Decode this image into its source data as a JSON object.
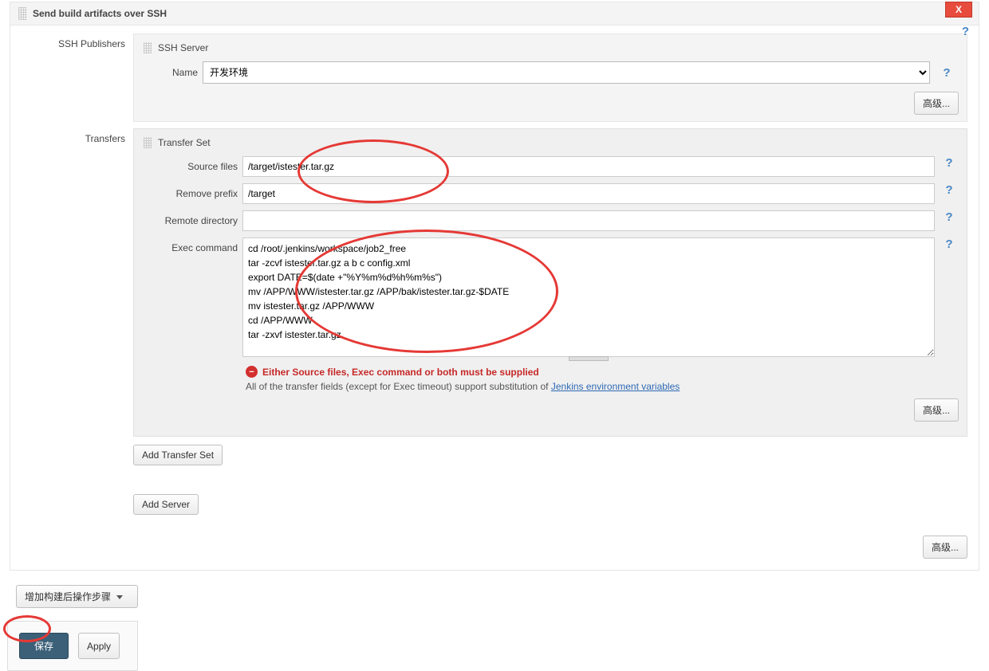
{
  "section": {
    "title": "Send build artifacts over SSH",
    "close": "X"
  },
  "labels": {
    "ssh_publishers": "SSH Publishers",
    "ssh_server": "SSH Server",
    "name": "Name",
    "advanced": "高级...",
    "transfers": "Transfers",
    "transfer_set": "Transfer Set",
    "source_files": "Source files",
    "remove_prefix": "Remove prefix",
    "remote_directory": "Remote directory",
    "exec_command": "Exec command",
    "add_transfer_set": "Add Transfer Set",
    "add_server": "Add Server",
    "add_post_build": "增加构建后操作步骤",
    "save": "保存",
    "apply": "Apply",
    "help": "?"
  },
  "values": {
    "server_name": "开发环境",
    "source_files": "/target/istester.tar.gz",
    "remove_prefix": "/target",
    "remote_directory": "",
    "exec_command": "cd /root/.jenkins/workspace/job2_free\ntar -zcvf istester.tar.gz a b c config.xml\nexport DATE=$(date +\"%Y%m%d%h%m%s\")\nmv /APP/WWW/istester.tar.gz /APP/bak/istester.tar.gz-$DATE\nmv istester.tar.gz /APP/WWW\ncd /APP/WWW\ntar -zxvf istester.tar.gz"
  },
  "messages": {
    "error": "Either Source files, Exec command or both must be supplied",
    "note_prefix": "All of the transfer fields (except for Exec timeout) support substitution of ",
    "note_link": "Jenkins environment variables"
  }
}
